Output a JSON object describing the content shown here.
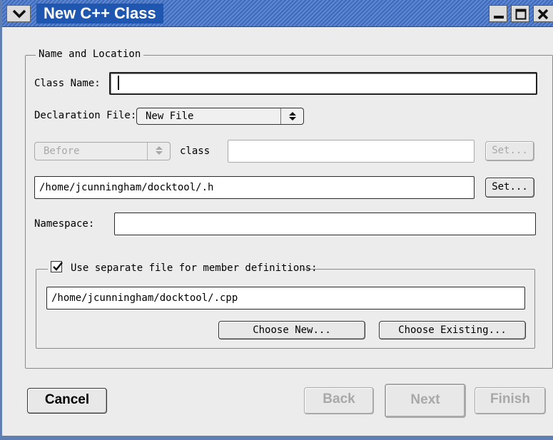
{
  "window": {
    "title": "New C++ Class",
    "icons": {
      "menu": "chevron-down-icon",
      "minimize": "minimize-icon",
      "maximize": "maximize-icon",
      "close": "close-icon"
    }
  },
  "name_location": {
    "legend": "Name and Location",
    "class_name_label": "Class Name:",
    "class_name_value": "",
    "declaration_file_label": "Declaration File:",
    "declaration_file_value": "New File",
    "position_select_value": "Before",
    "class_label": "class",
    "class_ref_value": "",
    "set_label_disabled": "Set...",
    "header_path": "/home/jcunningham/docktool/.h",
    "set_label": "Set...",
    "namespace_label": "Namespace:",
    "namespace_value": ""
  },
  "member_defs": {
    "checkbox_label": "Use separate file for member definitions:",
    "checked": true,
    "cpp_path": "/home/jcunningham/docktool/.cpp",
    "choose_new_label": "Choose New...",
    "choose_existing_label": "Choose Existing..."
  },
  "footer": {
    "cancel_label": "Cancel",
    "back_label": "Back",
    "next_label": "Next",
    "finish_label": "Finish"
  }
}
